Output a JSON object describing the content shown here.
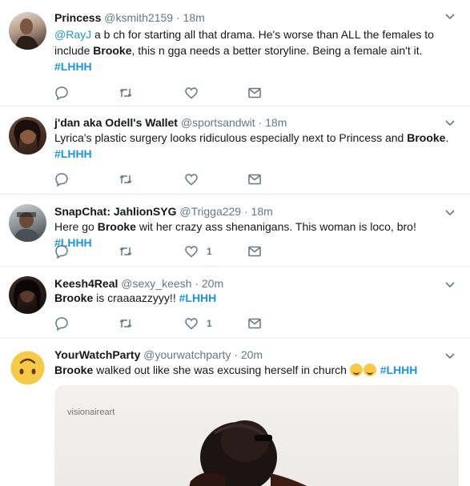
{
  "tweets": [
    {
      "name": "Princess",
      "handle": "@ksmith2159",
      "time": "18m",
      "mention": "@RayJ",
      "text_a": " a b  ch for starting all that drama. He's worse than ALL the females to include ",
      "bold_1": "Brooke",
      "text_b": ", this n  gga needs a better storyline. Being a female ain't it.",
      "hashtag": "#LHHH",
      "likes": ""
    },
    {
      "name": "j'dan aka Odell's Wallet",
      "handle": "@sportsandwit",
      "time": "18m",
      "text_a": "Lyrica's plastic surgery looks ridiculous especially next to Princess and ",
      "bold_1": "Brooke",
      "text_b": ".",
      "hashtag": "#LHHH",
      "likes": ""
    },
    {
      "name": "SnapChat: JahlionSYG",
      "handle": "@Trigga229",
      "time": "18m",
      "text_a": "Here go ",
      "bold_1": "Brooke",
      "text_b": " wit her crazy ass shenanigans. This woman is loco, bro! ",
      "hashtag": "#LHHH",
      "likes": "1"
    },
    {
      "name": "Keesh4Real",
      "handle": "@sexy_keesh",
      "time": "20m",
      "bold_1": "Brooke",
      "text_b": " is craaaazzyyy!! ",
      "hashtag": "#LHHH",
      "likes": "1"
    },
    {
      "name": "YourWatchParty",
      "handle": "@yourwatchparty",
      "time": "20m",
      "bold_1": "Brooke",
      "text_b": " walked out like she was excusing herself in church ",
      "hashtag": "#LHHH",
      "media_watermark": "visionaireart"
    }
  ],
  "separator": " · ",
  "icons": [
    "chevron-down-icon",
    "reply-icon",
    "retweet-icon",
    "like-icon",
    "message-icon",
    "grinning-sweat-emoji"
  ],
  "colors": {
    "link": "#1b95e0",
    "muted": "#657786",
    "border": "#e6ecf0",
    "text": "#14171a"
  }
}
